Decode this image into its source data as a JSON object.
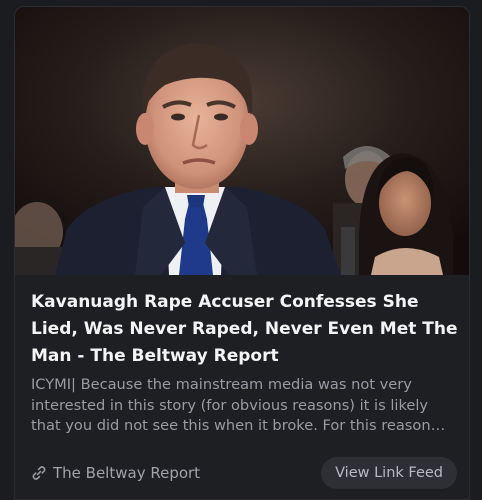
{
  "post": {
    "headline": "Kavanuagh Rape Accuser Confesses She Lied, Was Never Raped, Never Even Met The Man - The Beltway Report",
    "summary": "ICYMI| Because the mainstream media was not very interested in this story (for obvious reasons) it is likely that you did not see this when it broke.  For this reason…",
    "source_label": "The Beltway Report",
    "source_icon": "link-icon",
    "view_button_label": "View Link Feed"
  },
  "colors": {
    "background": "#1b1c20",
    "card": "#1e1f23",
    "headline": "#f4f4f5",
    "summary": "#9a9ba3",
    "button_bg": "#2e2f35"
  }
}
